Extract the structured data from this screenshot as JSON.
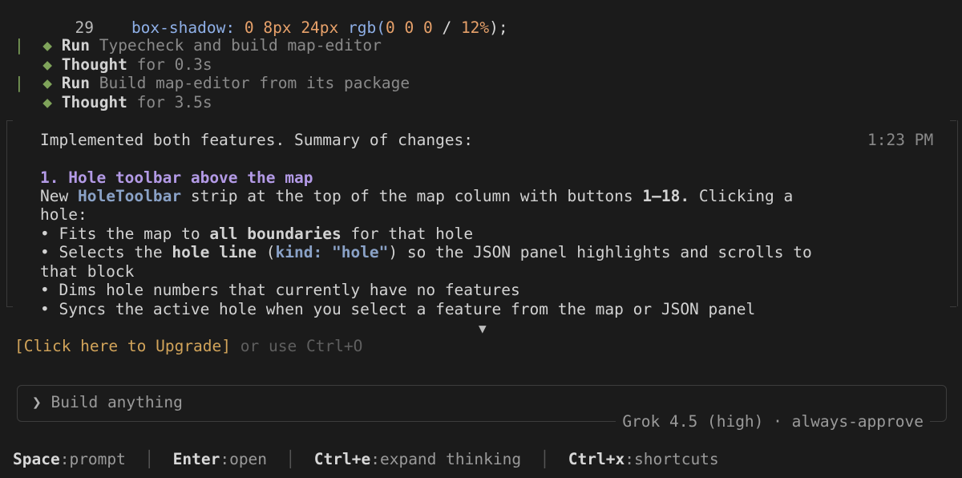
{
  "code_line": {
    "number": "29",
    "property": "box-shadow:",
    "v1": "0",
    "v2": "8px",
    "v3": "24px",
    "fn": "rgb(",
    "args": "0 0 0",
    "slash": " / ",
    "pct": "12%",
    "end": ");"
  },
  "activity": [
    {
      "bar": "|",
      "diamond": "◆",
      "verb": "Run",
      "text": " Typecheck and build map-editor"
    },
    {
      "bar": "",
      "diamond": "◆",
      "verb": "Thought",
      "text": " for 0.3s"
    },
    {
      "bar": "|",
      "diamond": "◆",
      "verb": "Run",
      "text": " Build map-editor from its package"
    },
    {
      "bar": "",
      "diamond": "◆",
      "verb": "Thought",
      "text": " for 3.5s"
    }
  ],
  "summary": {
    "intro": "Implemented both features. Summary of changes:",
    "time": "1:23 PM",
    "heading": "1. Hole toolbar above the map",
    "para_a": "New ",
    "para_component": "HoleToolbar",
    "para_b": " strip at the top of the map column with buttons ",
    "para_range": "1–18.",
    "para_c": " Clicking a",
    "para_d": "hole:",
    "b1_a": "• Fits the map to ",
    "b1_bold": "all boundaries",
    "b1_b": " for that hole",
    "b2_a": "• Selects the ",
    "b2_bold": "hole line",
    "b2_paren_open": " (",
    "b2_code": "kind: \"hole\"",
    "b2_paren_close": ")",
    "b2_b": " so the JSON panel highlights and scrolls to",
    "b2_c": "that block",
    "b3": "• Dims hole numbers that currently have no features",
    "b4": "• Syncs the active hole when you select a feature from the map or JSON panel",
    "more_arrow": "▼"
  },
  "upgrade": {
    "link": "[Click here to Upgrade]",
    "hint": " or use Ctrl+O"
  },
  "prompt": {
    "chevron": "❯",
    "placeholder": "Build anything",
    "model": "Grok 4.5 (high) · always-approve"
  },
  "footer": [
    {
      "key": "Space",
      "action": "prompt"
    },
    {
      "key": "Enter",
      "action": "open"
    },
    {
      "key": "Ctrl+e",
      "action": "expand thinking"
    },
    {
      "key": "Ctrl+x",
      "action": "shortcuts"
    }
  ],
  "colors": {
    "background": "#1b1b1b",
    "accent_green": "#7fa35a",
    "heading_purple": "#b39ae6",
    "upgrade_yellow": "#d2a45a"
  }
}
